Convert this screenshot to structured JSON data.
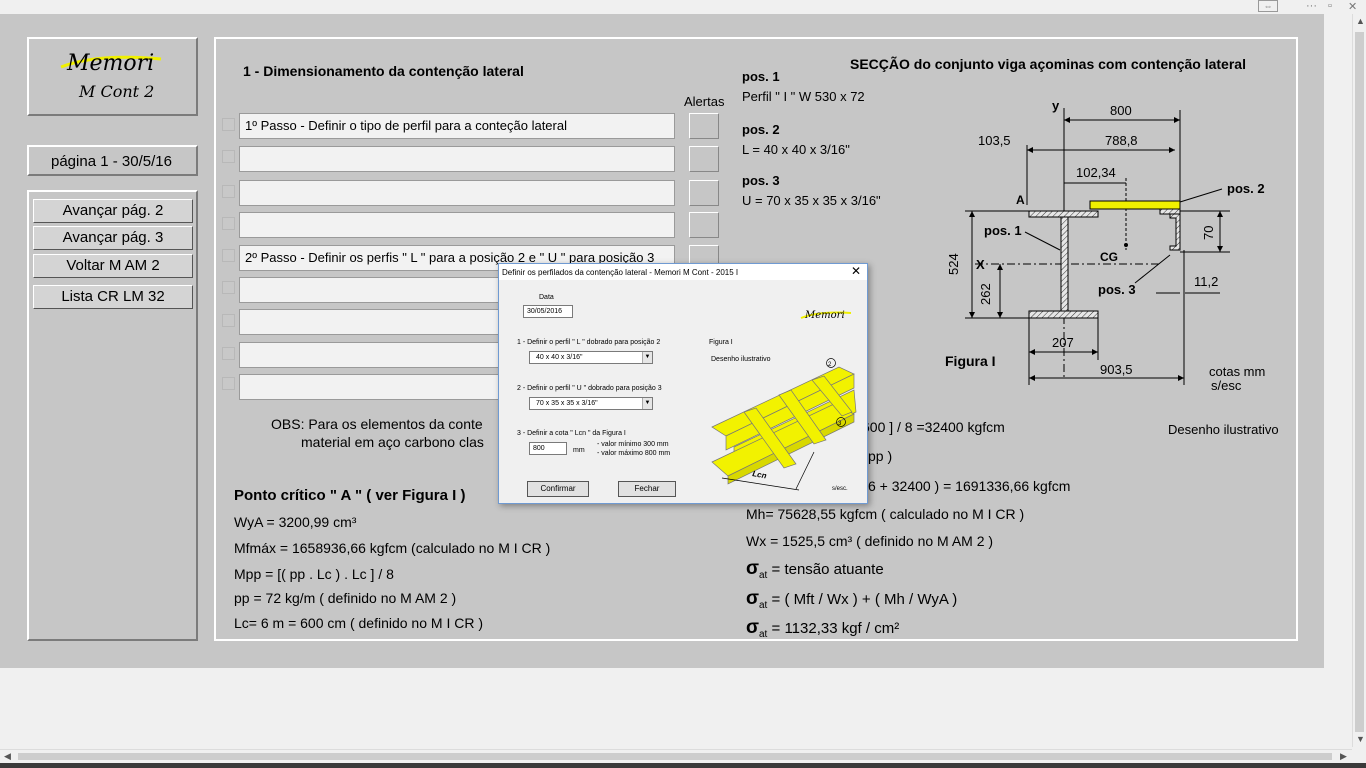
{
  "window": {
    "top_buttons": [
      "⇔",
      "···",
      "▫",
      "✕"
    ]
  },
  "logo": {
    "title": "Memori",
    "subtitle": "M Cont 2"
  },
  "page_info": {
    "label": "página 1 -   30/5/16"
  },
  "nav": {
    "buttons": [
      "Avançar pág. 2",
      "Avançar pág. 3",
      "Voltar M AM 2",
      "Lista CR LM 32"
    ]
  },
  "main": {
    "heading": "1 - Dimensionamento da contenção lateral",
    "alerts_label": "Alertas",
    "steps": [
      "1º Passo - Definir o tipo de perfil para a conteção lateral",
      "",
      "",
      "",
      "2º Passo - Definir os perfis \" L \" para a posição 2 e \" U \" para posição 3",
      "",
      "",
      "",
      ""
    ],
    "obs_line1": "OBS: Para os elementos da conte",
    "obs_line2": "material em aço carbono clas",
    "critical": {
      "title": "Ponto crítico \" A \" ( ver Figura I )",
      "lines": [
        "WyA = 3200,99  cm³",
        "Mfmáx = 1658936,66 kgfcm (calculado no M I CR )",
        "Mpp = [( pp . Lc ) . Lc ] / 8",
        "pp = 72 kg/m  ( definido no M AM 2 )",
        "Lc= 6 m = 600 cm  ( definido no M I CR )"
      ]
    }
  },
  "right": {
    "section_title": "SECÇÃO do conjunto viga açominas com contenção lateral",
    "positions": [
      {
        "label": "pos. 1",
        "value": "Perfil \" I \" W 530 x 72"
      },
      {
        "label": "pos. 2",
        "value": "L =  40 x 40 x 3/16\""
      },
      {
        "label": "pos. 3",
        "value": "U = 70 x 35 x 35 x 3/16\""
      }
    ],
    "calc_lines": [
      "600 ] / 8 =32400 kgfcm",
      "pp )",
      "6 + 32400 ) = 1691336,66 kgfcm",
      "Mh= 75628,55 kgfcm ( calculado no M I CR )",
      "Wx = 1525,5 cm³ ( definido no M AM 2 )"
    ],
    "sigma_symbol": "σ",
    "sigma_sub": "at",
    "sigma_lines": [
      "= tensão atuante",
      "= ( Mft / Wx ) + ( Mh / WyA )",
      "= 1132,33 kgf / cm²"
    ],
    "desenho_label": "Desenho ilustrativo"
  },
  "figure": {
    "caption": "Figura I",
    "units": "cotas mm",
    "scale": "s/esc",
    "dims": {
      "d800": "800",
      "d103": "103,5",
      "d788": "788,8",
      "d102": "102,34",
      "d524": "524",
      "d262": "262",
      "d70": "70",
      "d11": "11,2",
      "d207": "207",
      "d903": "903,5"
    },
    "labels": {
      "y": "y",
      "x": "X",
      "a": "A",
      "cg": "CG",
      "pos1": "pos. 1",
      "pos2": "pos. 2",
      "pos3": "pos. 3"
    },
    "colors": {
      "highlight": "#f0f000"
    }
  },
  "dialog": {
    "title": "Definir os perfilados da contenção lateral - Memori M Cont - 2015 I",
    "date_label": "Data",
    "date_value": "30/05/2016",
    "step1_label": "1 - Definir o perfil  \" L \"  dobrado para posição 2",
    "step1_value": "40 x 40 x 3/16\"",
    "step2_label": "2 - Definir o perfil  \" U \" dobrado para posição 3",
    "step2_value": "70 x 35 x 35 x 3/16\"",
    "step3_label": "3 - Definir a cota \" Lcn \" da Figura I",
    "lcn_value": "800",
    "lcn_unit": "mm",
    "min_note": "- valor mínimo  300 mm",
    "max_note": "- valor máximo 800 mm",
    "figure_label": "Figura I",
    "figure_desc": "Desenho ilustrativo",
    "figure_dim": "Lcn",
    "figure_scale": "s/esc.",
    "figure_num1": "2",
    "figure_num2": "3",
    "logo": "Memori",
    "confirm_label": "Confirmar",
    "close_label": "Fechar"
  }
}
